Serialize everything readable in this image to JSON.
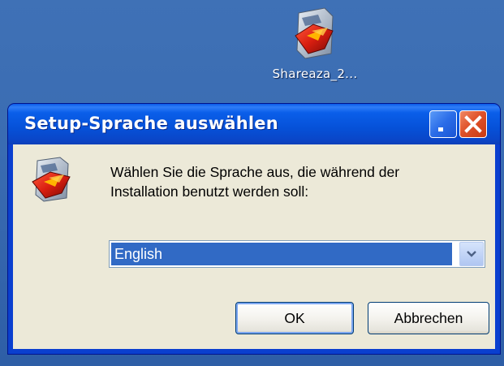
{
  "desktop": {
    "icon_label": "Shareaza_2...",
    "icon": "shareaza-icon"
  },
  "dialog": {
    "title": "Setup-Sprache auswählen",
    "help_button_icon": "help-icon",
    "close_button_icon": "close-icon",
    "app_icon": "setup-icon",
    "prompt_line1": "Wählen Sie die Sprache aus, die während der",
    "prompt_line2": "Installation benutzt werden soll:",
    "language_select": {
      "selected": "English",
      "dropdown_icon": "chevron-down-icon"
    },
    "ok_label": "OK",
    "cancel_label": "Abbrechen"
  },
  "colors": {
    "titlebar": "#0651d8",
    "dialog_bg": "#ece9d8",
    "selection": "#316ac5",
    "close_button": "#e0522a"
  }
}
